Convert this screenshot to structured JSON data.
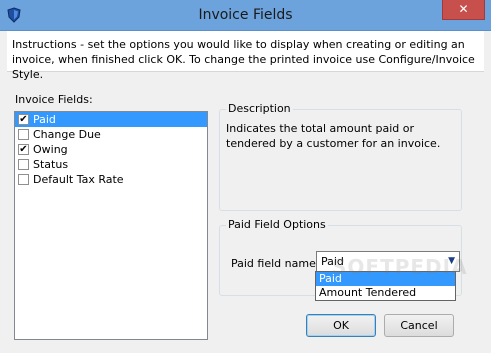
{
  "window": {
    "title": "Invoice Fields",
    "close_label": "✕",
    "titlebar_color": "#6da3dd",
    "close_color": "#c7504d"
  },
  "instructions": {
    "text": "Instructions - set the options you would like to display when creating or editing an invoice, when finished click OK. To change the printed invoice use Configure/Invoice Style."
  },
  "fields": {
    "label": "Invoice Fields:",
    "items": [
      {
        "label": "Paid",
        "checked": true,
        "selected": true
      },
      {
        "label": "Change Due",
        "checked": false,
        "selected": false
      },
      {
        "label": "Owing",
        "checked": true,
        "selected": false
      },
      {
        "label": "Status",
        "checked": false,
        "selected": false
      },
      {
        "label": "Default Tax Rate",
        "checked": false,
        "selected": false
      }
    ]
  },
  "description": {
    "title": "Description",
    "text": "Indicates the total amount paid or tendered by a customer for an invoice."
  },
  "options": {
    "title": "Paid Field Options",
    "field_label": "Paid field name:",
    "selected_value": "Paid",
    "dropdown_items": [
      "Paid",
      "Amount Tendered"
    ]
  },
  "watermark": "SOFTPEDIA",
  "buttons": {
    "ok": "OK",
    "cancel": "Cancel"
  },
  "colors": {
    "selection": "#3399ff",
    "background": "#f0f0f0"
  }
}
